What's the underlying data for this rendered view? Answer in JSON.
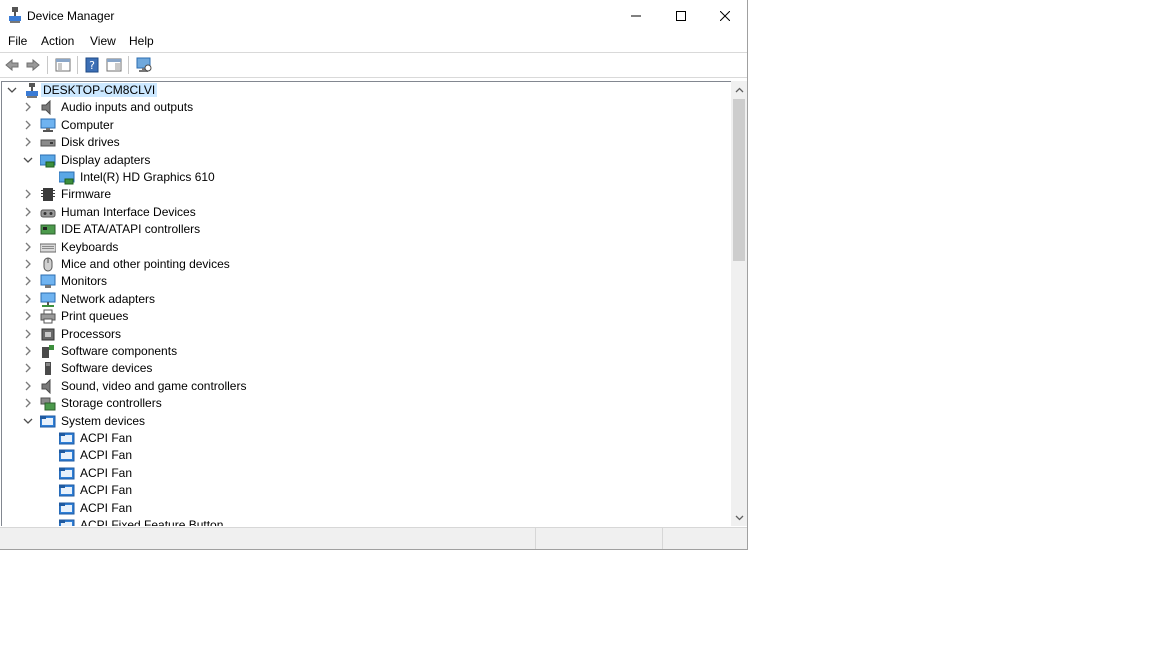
{
  "window": {
    "title": "Device Manager"
  },
  "menu": [
    "File",
    "Action",
    "View",
    "Help"
  ],
  "tree": {
    "root": "DESKTOP-CM8CLVI",
    "items": [
      {
        "label": "Audio inputs and outputs",
        "icon": "speaker-icon",
        "expanded": false
      },
      {
        "label": "Computer",
        "icon": "computer-icon",
        "expanded": false
      },
      {
        "label": "Disk drives",
        "icon": "disk-drive-icon",
        "expanded": false
      },
      {
        "label": "Display adapters",
        "icon": "display-adapter-icon",
        "expanded": true,
        "children": [
          {
            "label": "Intel(R) HD Graphics 610",
            "icon": "display-adapter-icon"
          }
        ]
      },
      {
        "label": "Firmware",
        "icon": "chip-icon",
        "expanded": false
      },
      {
        "label": "Human Interface Devices",
        "icon": "hid-icon",
        "expanded": false
      },
      {
        "label": "IDE ATA/ATAPI controllers",
        "icon": "ide-controller-icon",
        "expanded": false
      },
      {
        "label": "Keyboards",
        "icon": "keyboard-icon",
        "expanded": false
      },
      {
        "label": "Mice and other pointing devices",
        "icon": "mouse-icon",
        "expanded": false
      },
      {
        "label": "Monitors",
        "icon": "monitor-icon",
        "expanded": false
      },
      {
        "label": "Network adapters",
        "icon": "network-adapter-icon",
        "expanded": false
      },
      {
        "label": "Print queues",
        "icon": "printer-icon",
        "expanded": false
      },
      {
        "label": "Processors",
        "icon": "processor-icon",
        "expanded": false
      },
      {
        "label": "Software components",
        "icon": "software-component-icon",
        "expanded": false
      },
      {
        "label": "Software devices",
        "icon": "software-device-icon",
        "expanded": false
      },
      {
        "label": "Sound, video and game controllers",
        "icon": "speaker-icon",
        "expanded": false
      },
      {
        "label": "Storage controllers",
        "icon": "storage-controller-icon",
        "expanded": false
      },
      {
        "label": "System devices",
        "icon": "system-folder-icon",
        "expanded": true,
        "children": [
          {
            "label": "ACPI Fan",
            "icon": "system-folder-icon"
          },
          {
            "label": "ACPI Fan",
            "icon": "system-folder-icon"
          },
          {
            "label": "ACPI Fan",
            "icon": "system-folder-icon"
          },
          {
            "label": "ACPI Fan",
            "icon": "system-folder-icon"
          },
          {
            "label": "ACPI Fan",
            "icon": "system-folder-icon"
          },
          {
            "label": "ACPI Fixed Feature Button",
            "icon": "system-folder-icon"
          }
        ]
      }
    ]
  },
  "colors": {
    "selection": "#cce8ff",
    "accent": "#0078d7"
  }
}
